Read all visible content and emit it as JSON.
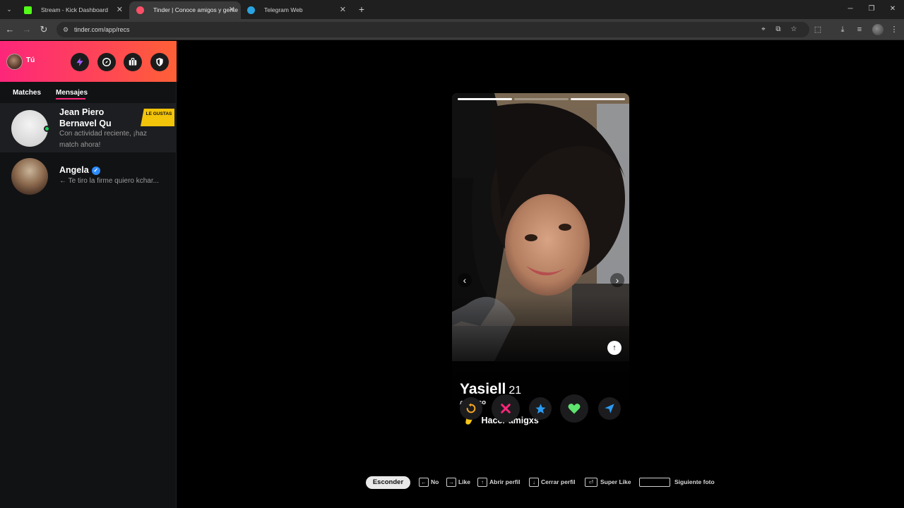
{
  "browser": {
    "tabs": [
      {
        "title": "Stream - Kick Dashboard",
        "active": false
      },
      {
        "title": "Tinder | Conoce amigos y gente",
        "active": true
      },
      {
        "title": "Telegram Web",
        "active": false
      }
    ],
    "new_tab": "+",
    "url": "tinder.com/app/recs"
  },
  "sidebar": {
    "me_label": "Tú",
    "tabs": [
      "Matches",
      "Mensajes"
    ],
    "messages": [
      {
        "name": "Jean Piero Bernavel Qu",
        "preview": "Con actividad reciente, ¡haz match ahora!",
        "badge": "LE GUSTAS"
      },
      {
        "name": "Angela",
        "preview": "← Te tiro la firme quiero kchar..."
      }
    ]
  },
  "card": {
    "name": "Yasiell",
    "age": "21",
    "busco_label": "Busco",
    "intent": "Hacer amigxs",
    "photo_count": 3,
    "current_photo": 1
  },
  "hints": {
    "hide": "Esconder",
    "items": [
      "No",
      "Like",
      "Abrir perfil",
      "Cerrar perfil",
      "Super Like",
      "Siguiente foto"
    ]
  },
  "colors": {
    "brand_gradient_start": "#fd267a",
    "brand_gradient_end": "#ff6036",
    "online": "#1ed760",
    "badge": "#f2c40a"
  }
}
